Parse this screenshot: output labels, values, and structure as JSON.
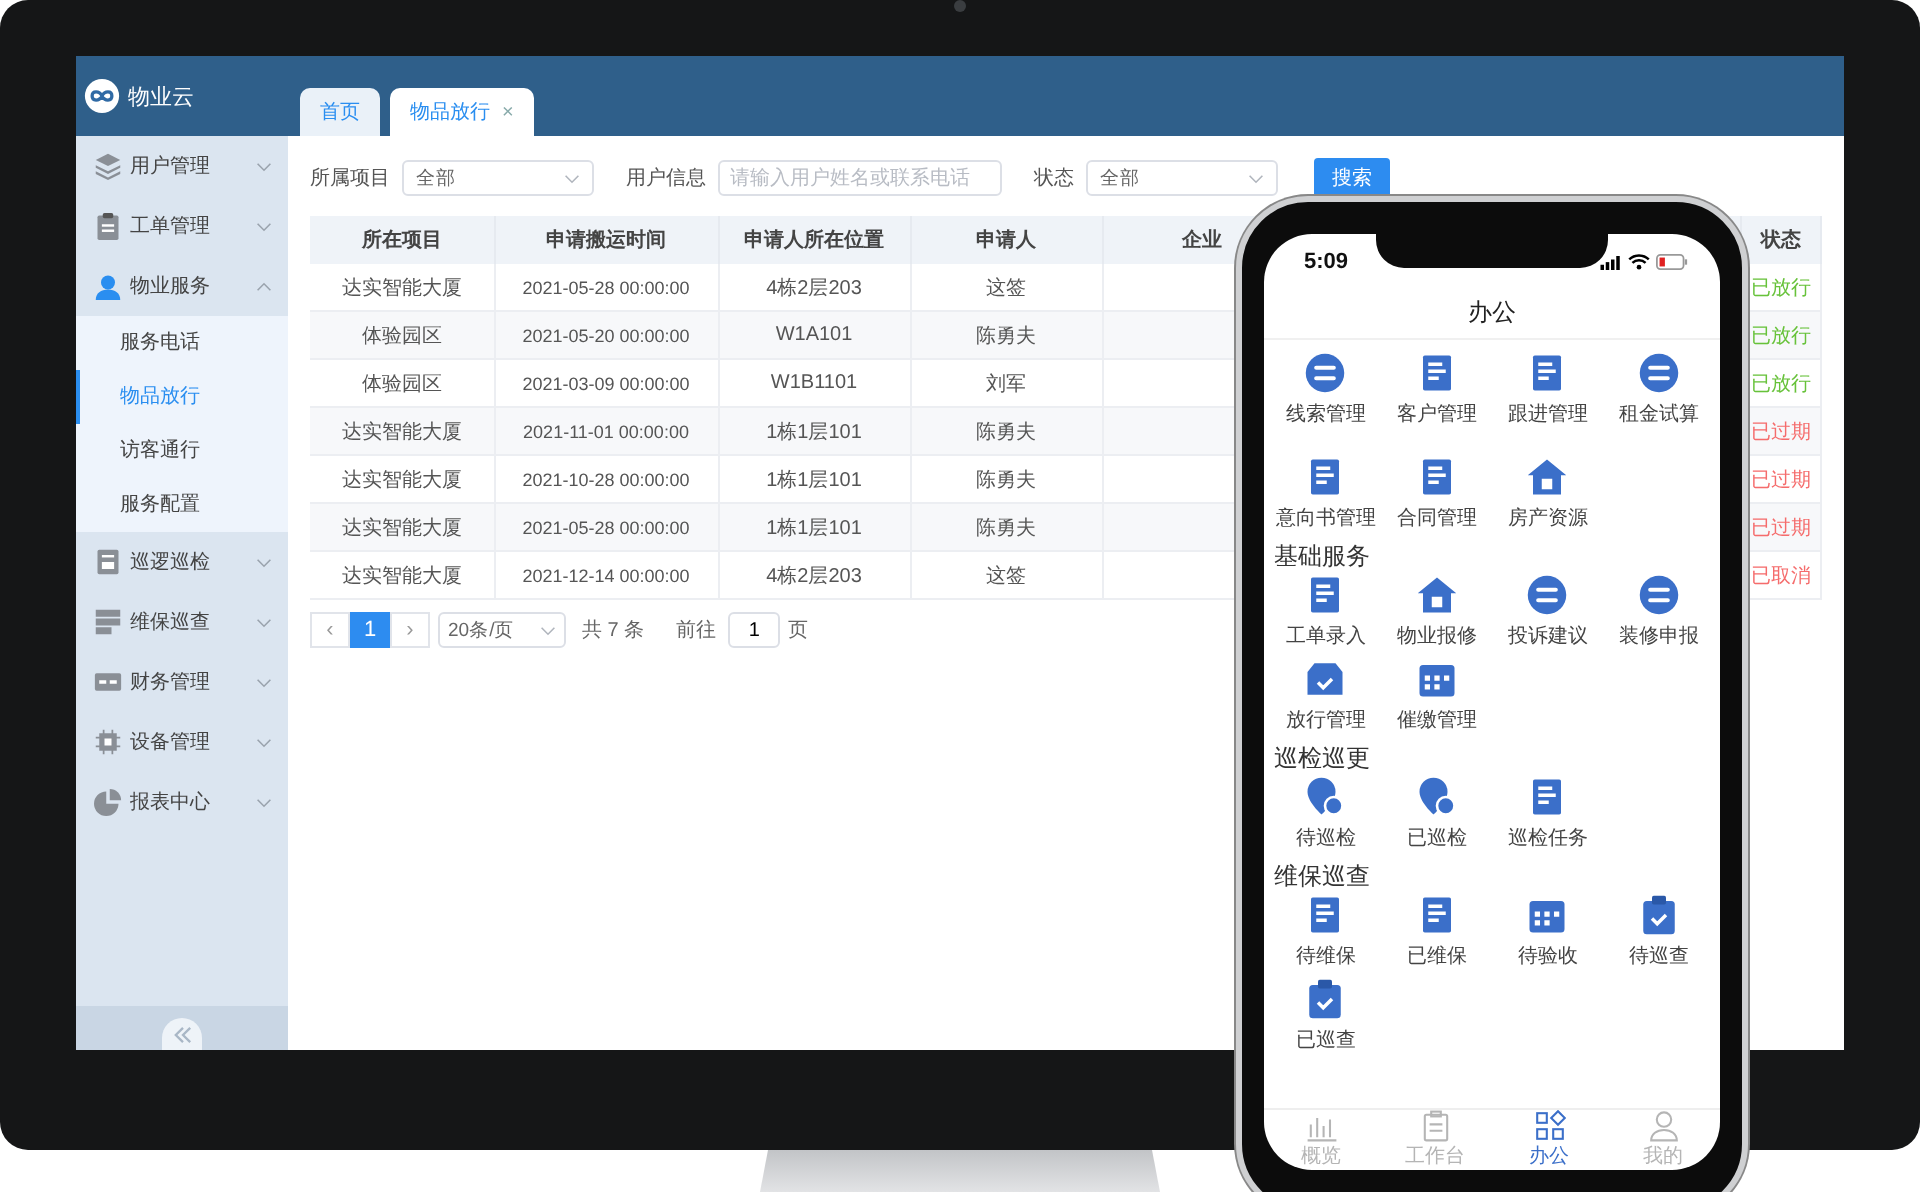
{
  "app": {
    "logo_text": "物业云"
  },
  "tabs": [
    {
      "label": "首页",
      "selected": false
    },
    {
      "label": "物品放行",
      "selected": true,
      "close_glyph": "×"
    }
  ],
  "sidebar": {
    "items": [
      {
        "label": "用户管理",
        "kind": "layers",
        "expanded": false
      },
      {
        "label": "工单管理",
        "kind": "clipboard",
        "expanded": false
      },
      {
        "label": "物业服务",
        "kind": "person",
        "expanded": true,
        "children": [
          {
            "label": "服务电话",
            "selected": false
          },
          {
            "label": "物品放行",
            "selected": true
          },
          {
            "label": "访客通行",
            "selected": false
          },
          {
            "label": "服务配置",
            "selected": false
          }
        ]
      },
      {
        "label": "巡逻巡检",
        "kind": "document",
        "expanded": false
      },
      {
        "label": "维保巡查",
        "kind": "server",
        "expanded": false
      },
      {
        "label": "财务管理",
        "kind": "card",
        "expanded": false
      },
      {
        "label": "设备管理",
        "kind": "chip",
        "expanded": false
      },
      {
        "label": "报表中心",
        "kind": "pie",
        "expanded": false
      }
    ]
  },
  "filters": [
    {
      "label": "所属项目",
      "kind": "select",
      "value": "全部"
    },
    {
      "label": "用户信息",
      "kind": "input",
      "placeholder": "请输入用户姓名或联系电话"
    },
    {
      "label": "状态",
      "kind": "select",
      "value": "全部"
    }
  ],
  "search_button": "搜索",
  "table": {
    "columns": [
      "所在项目",
      "申请搬运时间",
      "申请人所在位置",
      "申请人",
      "企业",
      "状态"
    ],
    "rows": [
      {
        "cells": [
          "达实智能大厦",
          "2021-05-28 00:00:00",
          "4栋2层203",
          "这签"
        ],
        "status": {
          "text": "已放行",
          "color": "#67c23a"
        }
      },
      {
        "cells": [
          "体验园区",
          "2021-05-20 00:00:00",
          "W1A101",
          "陈勇夫"
        ],
        "status": {
          "text": "已放行",
          "color": "#67c23a"
        }
      },
      {
        "cells": [
          "体验园区",
          "2021-03-09 00:00:00",
          "W1B1101",
          "刘军"
        ],
        "status": {
          "text": "已放行",
          "color": "#67c23a"
        }
      },
      {
        "cells": [
          "达实智能大厦",
          "2021-11-01 00:00:00",
          "1栋1层101",
          "陈勇夫"
        ],
        "status": {
          "text": "已过期",
          "color": "#f56c6c"
        }
      },
      {
        "cells": [
          "达实智能大厦",
          "2021-10-28 00:00:00",
          "1栋1层101",
          "陈勇夫"
        ],
        "status": {
          "text": "已过期",
          "color": "#f56c6c"
        }
      },
      {
        "cells": [
          "达实智能大厦",
          "2021-05-28 00:00:00",
          "1栋1层101",
          "陈勇夫"
        ],
        "status": {
          "text": "已过期",
          "color": "#f56c6c"
        }
      },
      {
        "cells": [
          "达实智能大厦",
          "2021-12-14 00:00:00",
          "4栋2层203",
          "这签"
        ],
        "status": {
          "text": "已取消",
          "color": "#f56c6c"
        }
      }
    ]
  },
  "pagination": {
    "prev": "‹",
    "pages": [
      {
        "label": "1",
        "selected": true
      }
    ],
    "next": "›",
    "page_size": "20条/页",
    "total": "共 7 条",
    "goto_label": "前往",
    "goto_value": "1",
    "goto_unit": "页"
  },
  "phone": {
    "time": "5:09",
    "title": "办公",
    "sections": [
      {
        "apps": [
          {
            "label": "线索管理",
            "kind": "circle"
          },
          {
            "label": "客户管理",
            "kind": "document"
          },
          {
            "label": "跟进管理",
            "kind": "document"
          },
          {
            "label": "租金试算",
            "kind": "circle"
          },
          {
            "label": "意向书管理",
            "kind": "document"
          },
          {
            "label": "合同管理",
            "kind": "document"
          },
          {
            "label": "房产资源",
            "kind": "house"
          }
        ]
      },
      {
        "heading": "基础服务",
        "apps": [
          {
            "label": "工单录入",
            "kind": "document"
          },
          {
            "label": "物业报修",
            "kind": "house"
          },
          {
            "label": "投诉建议",
            "kind": "circle"
          },
          {
            "label": "装修申报",
            "kind": "circle"
          },
          {
            "label": "放行管理",
            "kind": "tray"
          },
          {
            "label": "催缴管理",
            "kind": "calendar"
          }
        ]
      },
      {
        "heading": "巡检巡更",
        "apps": [
          {
            "label": "待巡检",
            "kind": "pin"
          },
          {
            "label": "已巡检",
            "kind": "pin"
          },
          {
            "label": "巡检任务",
            "kind": "document"
          }
        ]
      },
      {
        "heading": "维保巡查",
        "apps": [
          {
            "label": "待维保",
            "kind": "document"
          },
          {
            "label": "已维保",
            "kind": "document"
          },
          {
            "label": "待验收",
            "kind": "calendar"
          },
          {
            "label": "待巡查",
            "kind": "clipboard"
          },
          {
            "label": "已巡查",
            "kind": "clipboard"
          }
        ]
      }
    ],
    "tabbar": [
      {
        "label": "概览",
        "kind": "chart",
        "selected": false
      },
      {
        "label": "工作台",
        "kind": "clipboard",
        "selected": false
      },
      {
        "label": "办公",
        "kind": "grid",
        "selected": true
      },
      {
        "label": "我的",
        "kind": "person",
        "selected": false
      }
    ]
  }
}
